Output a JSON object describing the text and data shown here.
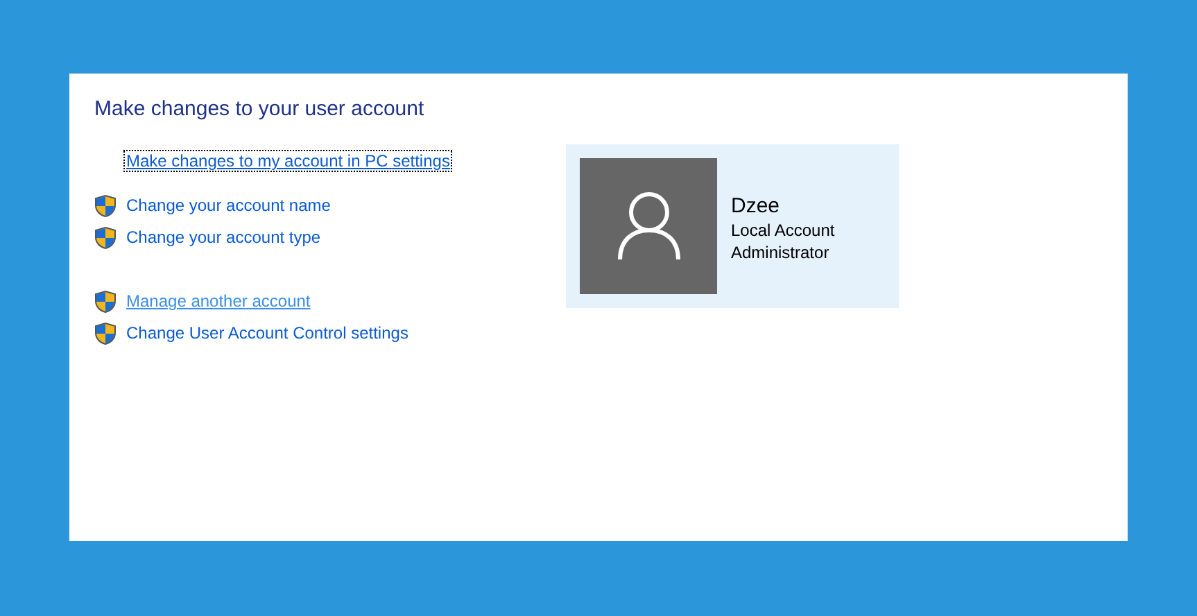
{
  "title": "Make changes to your user account",
  "link_groups": [
    [
      {
        "label": "Make changes to my account in PC settings",
        "shield": false,
        "focused": true,
        "hovered": false
      }
    ],
    [
      {
        "label": "Change your account name",
        "shield": true,
        "focused": false,
        "hovered": false
      },
      {
        "label": "Change your account type",
        "shield": true,
        "focused": false,
        "hovered": false
      }
    ],
    [
      {
        "label": "Manage another account",
        "shield": true,
        "focused": false,
        "hovered": true
      },
      {
        "label": "Change User Account Control settings",
        "shield": true,
        "focused": false,
        "hovered": false
      }
    ]
  ],
  "account": {
    "name": "Dzee",
    "details": [
      "Local Account",
      "Administrator"
    ]
  }
}
